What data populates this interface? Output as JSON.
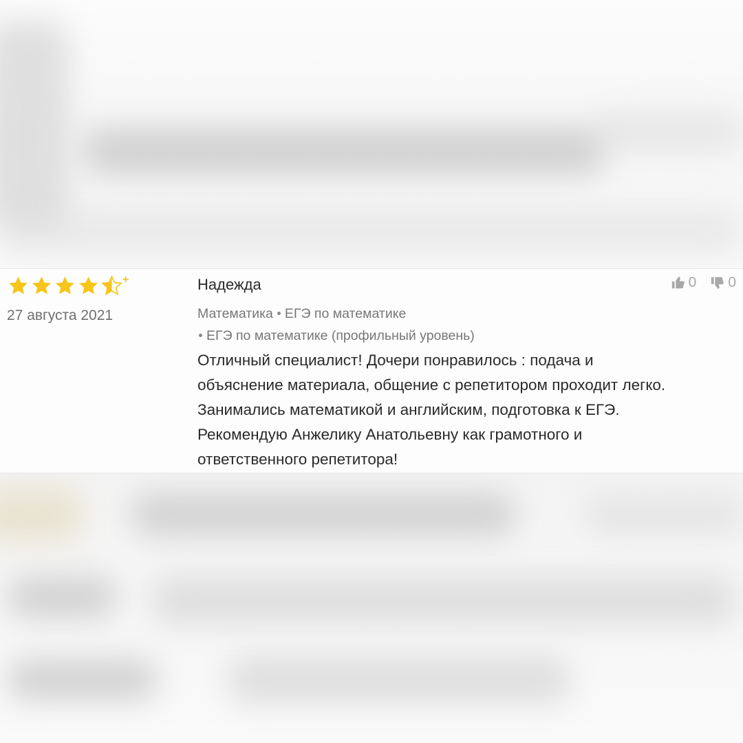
{
  "review": {
    "rating": 4.5,
    "rating_max": 5,
    "rating_extra_mark": "+",
    "date": "27 августа 2021",
    "author": "Надежда",
    "subjects": [
      "Математика",
      "ЕГЭ по математике",
      "ЕГЭ по математике (профильный уровень)"
    ],
    "text": "Отличный специалист! Дочери понравилось : подача и\nобъяснение материала, общение с репетитором проходит легко.\nЗанимались математикой и английским, подготовка к ЕГЭ.\nРекомендую Анжелику Анатольевну как грамотного и\nответственного репетитора!",
    "likes": "0",
    "dislikes": "0"
  },
  "colors": {
    "star": "#f5c518",
    "vote": "#a8a8a8"
  },
  "icons": {
    "like": "thumbs-up-icon",
    "dislike": "thumbs-down-icon",
    "star": "star-icon"
  }
}
